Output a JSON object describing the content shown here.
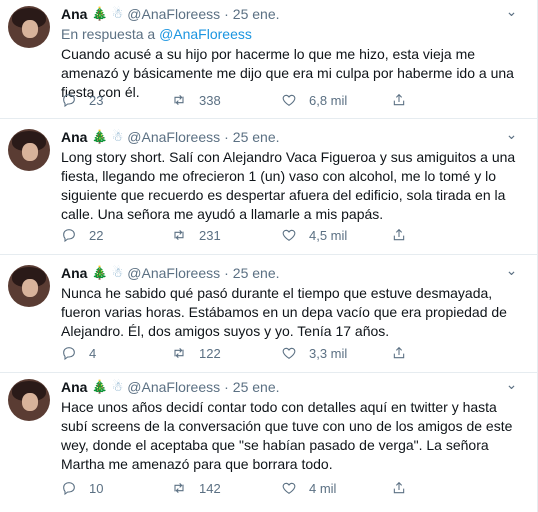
{
  "tweets": [
    {
      "name": "Ana",
      "emojis": [
        "🎄",
        "☃"
      ],
      "handle": "@AnaFloreess",
      "dot": "·",
      "date": "25 ene.",
      "reply_prefix": "En respuesta a",
      "reply_to": "@AnaFloreess",
      "text": "Cuando acusé a su hijo por hacerme lo que me hizo, esta vieja me amenazó y básicamente me dijo que era mi culpa por haberme ido a una fiesta con él.",
      "replies": "23",
      "retweets": "338",
      "likes": "6,8 mil"
    },
    {
      "name": "Ana",
      "emojis": [
        "🎄",
        "☃"
      ],
      "handle": "@AnaFloreess",
      "dot": "·",
      "date": "25 ene.",
      "text": "Long story short. Salí con Alejandro Vaca Figueroa y sus amiguitos a una fiesta, llegando me ofrecieron 1 (un) vaso con alcohol, me lo tomé y lo siguiente que recuerdo es despertar afuera del edificio, sola tirada en la calle. Una señora me ayudó a llamarle a mis papás.",
      "replies": "22",
      "retweets": "231",
      "likes": "4,5 mil"
    },
    {
      "name": "Ana",
      "emojis": [
        "🎄",
        "☃"
      ],
      "handle": "@AnaFloreess",
      "dot": "·",
      "date": "25 ene.",
      "text": "Nunca he sabido qué pasó durante el tiempo que estuve desmayada, fueron varias horas. Estábamos en un depa vacío que era propiedad de Alejandro. Él, dos amigos suyos y yo. Tenía 17 años.",
      "replies": "4",
      "retweets": "122",
      "likes": "3,3 mil"
    },
    {
      "name": "Ana",
      "emojis": [
        "🎄",
        "☃"
      ],
      "handle": "@AnaFloreess",
      "dot": "·",
      "date": "25 ene.",
      "text": "Hace unos años decidí contar todo con detalles aquí en twitter y hasta subí screens de la conversación que tuve con uno de los amigos de este wey, donde el aceptaba que \"se habían pasado de verga\". La señora Martha me amenazó para que borrara todo.",
      "replies": "10",
      "retweets": "142",
      "likes": "4 mil"
    }
  ],
  "more_glyph": "⌄"
}
